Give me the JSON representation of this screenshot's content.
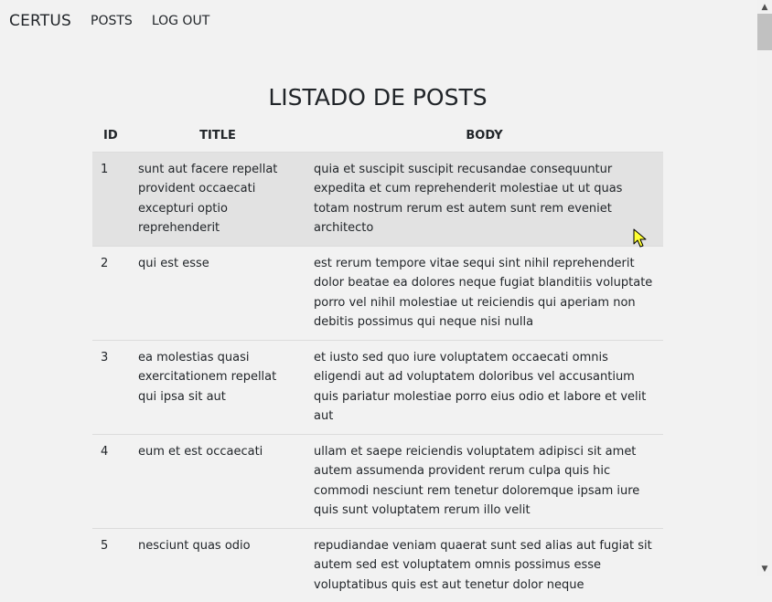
{
  "nav": {
    "brand": "CERTUS",
    "links": [
      "POSTS",
      "LOG OUT"
    ]
  },
  "page": {
    "title": "LISTADO DE POSTS"
  },
  "table": {
    "headers": [
      "ID",
      "TITLE",
      "BODY"
    ],
    "rows": [
      {
        "id": "1",
        "title": "sunt aut facere repellat provident occaecati excepturi optio reprehenderit",
        "body": "quia et suscipit suscipit recusandae consequuntur expedita et cum reprehenderit molestiae ut ut quas totam nostrum rerum est autem sunt rem eveniet architecto"
      },
      {
        "id": "2",
        "title": "qui est esse",
        "body": "est rerum tempore vitae sequi sint nihil reprehenderit dolor beatae ea dolores neque fugiat blanditiis voluptate porro vel nihil molestiae ut reiciendis qui aperiam non debitis possimus qui neque nisi nulla"
      },
      {
        "id": "3",
        "title": "ea molestias quasi exercitationem repellat qui ipsa sit aut",
        "body": "et iusto sed quo iure voluptatem occaecati omnis eligendi aut ad voluptatem doloribus vel accusantium quis pariatur molestiae porro eius odio et labore et velit aut"
      },
      {
        "id": "4",
        "title": "eum et est occaecati",
        "body": "ullam et saepe reiciendis voluptatem adipisci sit amet autem assumenda provident rerum culpa quis hic commodi nesciunt rem tenetur doloremque ipsam iure quis sunt voluptatem rerum illo velit"
      },
      {
        "id": "5",
        "title": "nesciunt quas odio",
        "body": "repudiandae veniam quaerat sunt sed alias aut fugiat sit autem sed est voluptatem omnis possimus esse voluptatibus quis est aut tenetur dolor neque"
      }
    ]
  },
  "colors": {
    "background": "#f2f2f2",
    "hover_row": "#e2e2e2",
    "text": "#212529"
  },
  "icons": {
    "scroll_up": "chevron-up-icon",
    "scroll_down": "chevron-down-icon",
    "cursor": "mouse-pointer-icon"
  }
}
